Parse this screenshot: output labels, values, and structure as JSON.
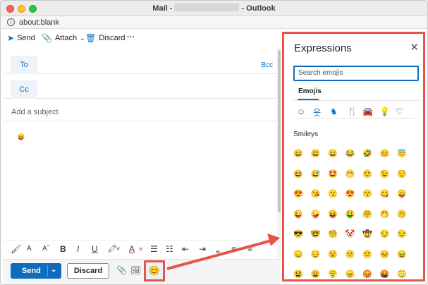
{
  "window": {
    "title_prefix": "Mail -",
    "title_suffix": "- Outlook",
    "url": "about:blank"
  },
  "toolbar": {
    "send_label": "Send",
    "attach_label": "Attach",
    "discard_label": "Discard",
    "more_label": "···"
  },
  "recipients": {
    "to_label": "To",
    "cc_label": "Cc",
    "bcc_label": "Bcc"
  },
  "subject_placeholder": "Add a subject",
  "body": {
    "emoji": "😛"
  },
  "format": {
    "icons": [
      "🖌",
      "A",
      "Aˆ",
      "B",
      "I",
      "U",
      "🖍",
      "˅",
      "A",
      "˅",
      "☰",
      "☷",
      "⇤",
      "⇥",
      "„",
      "≡",
      "≡"
    ]
  },
  "send_row": {
    "send_label": "Send",
    "send_chevron": "⌄",
    "discard_label": "Discard",
    "attach_icon": "📎",
    "image_icon": "🖼",
    "emoji_icon": "😊"
  },
  "expressions": {
    "title": "Expressions",
    "close_icon": "✕",
    "search_placeholder": "Search emojis",
    "tab_label": "Emojis",
    "category_icons": [
      "☺",
      "웃",
      "♞",
      "🍴",
      "🚘",
      "💡",
      "♡"
    ],
    "section_label": "Smileys",
    "emojis": [
      [
        "😀",
        "😃",
        "😄",
        "😂",
        "🤣",
        "😊",
        "😇"
      ],
      [
        "😆",
        "😅",
        "🤩",
        "😁",
        "🙂",
        "😉",
        "😌"
      ],
      [
        "😍",
        "😘",
        "😗",
        "😍",
        "😙",
        "😋",
        "😛"
      ],
      [
        "😜",
        "🤪",
        "😝",
        "🤑",
        "🤗",
        "🤭",
        "🤫"
      ],
      [
        "😎",
        "🤓",
        "🧐",
        "🤡",
        "🤠",
        "😏",
        "😒"
      ],
      [
        "😞",
        "😔",
        "😟",
        "😕",
        "🙁",
        "😣",
        "😖"
      ],
      [
        "😫",
        "😩",
        "😤",
        "😠",
        "😡",
        "🤬",
        "😳"
      ]
    ]
  },
  "colors": {
    "accent": "#0f6cbd",
    "highlight": "#e8534a"
  }
}
